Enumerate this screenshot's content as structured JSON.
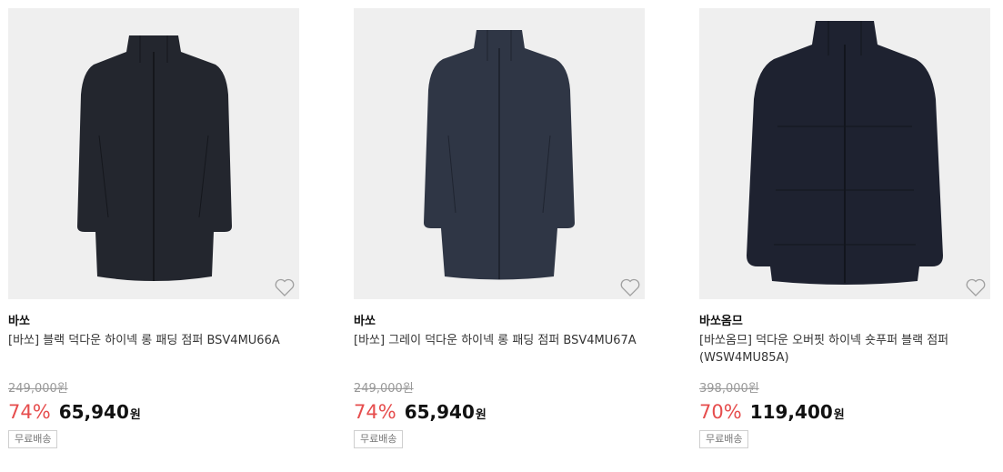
{
  "products": [
    {
      "brand": "바쏘",
      "title": "[바쏘] 블랙 덕다운 하이넥 롱 패딩 점퍼 BSV4MU66A",
      "original_price": "249,000원",
      "discount": "74%",
      "price": "65,940",
      "currency": "원",
      "shipping": "무료배송",
      "coat_color": "#23262e",
      "coat_style": "long"
    },
    {
      "brand": "바쏘",
      "title": "[바쏘] 그레이 덕다운 하이넥 롱 패딩 점퍼 BSV4MU67A",
      "original_price": "249,000원",
      "discount": "74%",
      "price": "65,940",
      "currency": "원",
      "shipping": "무료배송",
      "coat_color": "#2f3645",
      "coat_style": "long"
    },
    {
      "brand": "바쏘옴므",
      "title": "[바쏘옴므] 덕다운 오버핏 하이넥 숏푸퍼 블랙 점퍼 (WSW4MU85A)",
      "original_price": "398,000원",
      "discount": "70%",
      "price": "119,400",
      "currency": "원",
      "shipping": "무료배송",
      "coat_color": "#1e2230",
      "coat_style": "short"
    }
  ],
  "colors": {
    "discount": "#e64d4d",
    "thumb_bg": "#efefef"
  },
  "icons": {
    "wishlist": "heart-outline-icon"
  }
}
